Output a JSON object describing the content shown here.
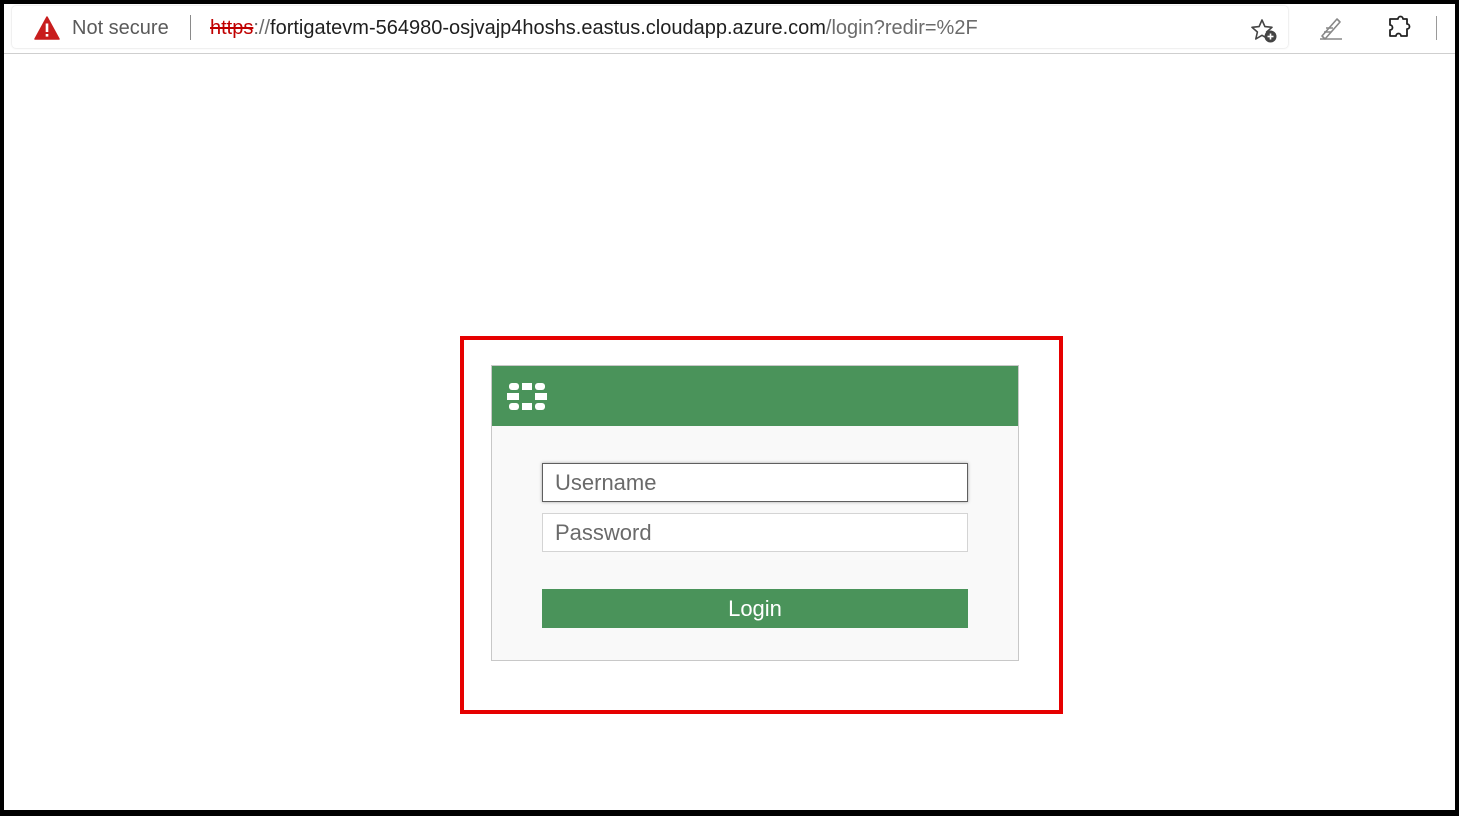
{
  "browser": {
    "security_label": "Not secure",
    "url": {
      "scheme": "https",
      "slashes": "://",
      "host": "fortigatevm-564980-osjvajp4hoshs.eastus.cloudapp.azure.com",
      "path": "/login?redir=%2F"
    },
    "icons": {
      "warning": "warning-triangle-icon",
      "favorite": "add-favorite-icon",
      "pen": "pen-icon",
      "extensions": "extensions-icon"
    }
  },
  "login": {
    "username_placeholder": "Username",
    "password_placeholder": "Password",
    "login_label": "Login",
    "logo": "fortinet-logo-icon"
  },
  "colors": {
    "brand_green": "#4a935a",
    "highlight_red": "#e60000",
    "insecure_red": "#c00000"
  }
}
